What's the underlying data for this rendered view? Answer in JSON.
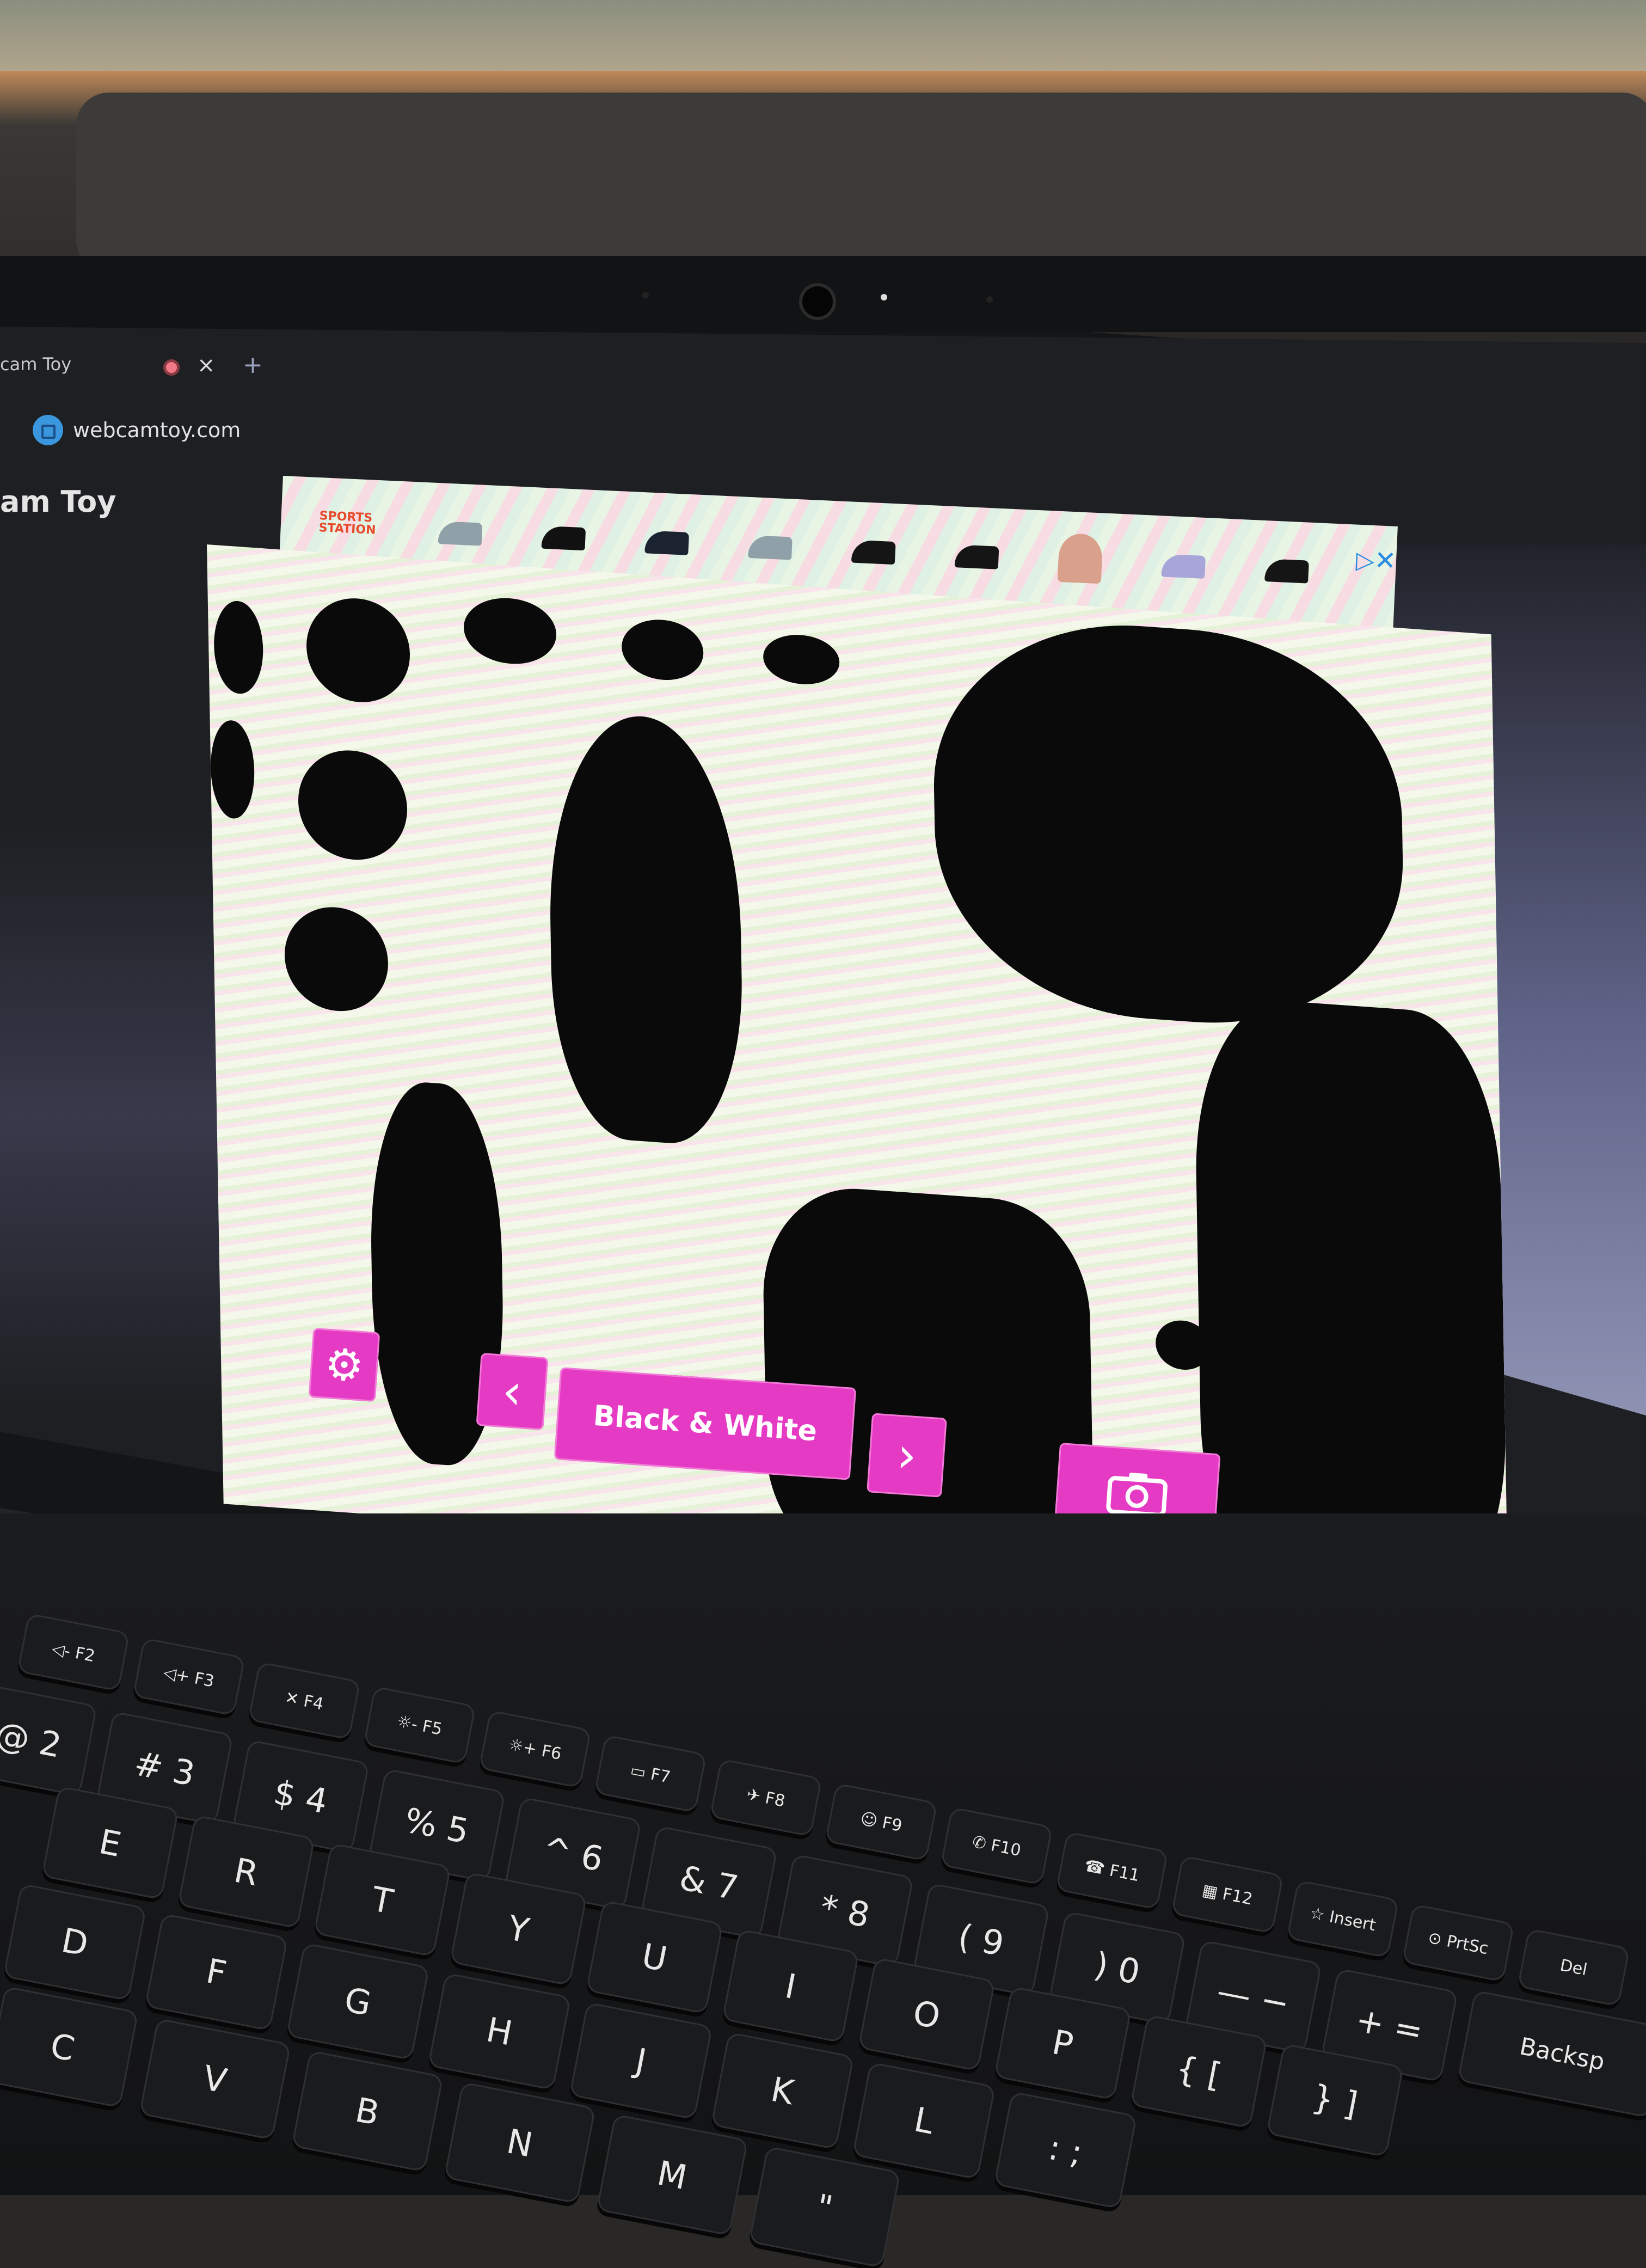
{
  "browser": {
    "tab_title": "cam Toy",
    "tab_close": "×",
    "new_tab": "+",
    "url": "webcamtoy.com"
  },
  "page": {
    "heading": "am Toy"
  },
  "ad": {
    "brand": "SPORTS STATION",
    "choices_icon": "▷",
    "close_icon": "✕",
    "items": [
      "sneaker-grey",
      "sneaker-black",
      "sneaker-blue-stripes",
      "sneaker-grey",
      "sneaker-black-stripes",
      "sneaker-black-stripes",
      "cap-pink",
      "sneaker-lilac",
      "sneaker-black-stripes"
    ]
  },
  "controls": {
    "settings_icon": "⚙",
    "prev_icon": "‹",
    "effect_label": "Black & White",
    "next_icon": "›",
    "capture_icon": "camera",
    "accent": "#e53bc4"
  },
  "keyboard": {
    "fn_row": [
      "◁- F2",
      "◁+ F3",
      "✕ F4",
      "☼- F5",
      "☼+ F6",
      "▭ F7",
      "✈ F8",
      "☺ F9",
      "✆ F10",
      "☎ F11",
      "▦ F12",
      "☆ Insert",
      "⊙ PrtSc",
      "Del"
    ],
    "num_row": [
      "@ 2",
      "# 3",
      "$ 4",
      "% 5",
      "^ 6",
      "& 7",
      "* 8",
      "( 9",
      ") 0",
      "— −",
      "+ =",
      "Backsp"
    ],
    "top_row": [
      "E",
      "R",
      "T",
      "Y",
      "U",
      "I",
      "O",
      "P",
      "{ [",
      "} ]"
    ],
    "home_row": [
      "D",
      "F",
      "G",
      "H",
      "J",
      "K",
      "L",
      ": ;"
    ],
    "bottom_row": [
      "C",
      "V",
      "B",
      "N",
      "M",
      "\""
    ]
  }
}
